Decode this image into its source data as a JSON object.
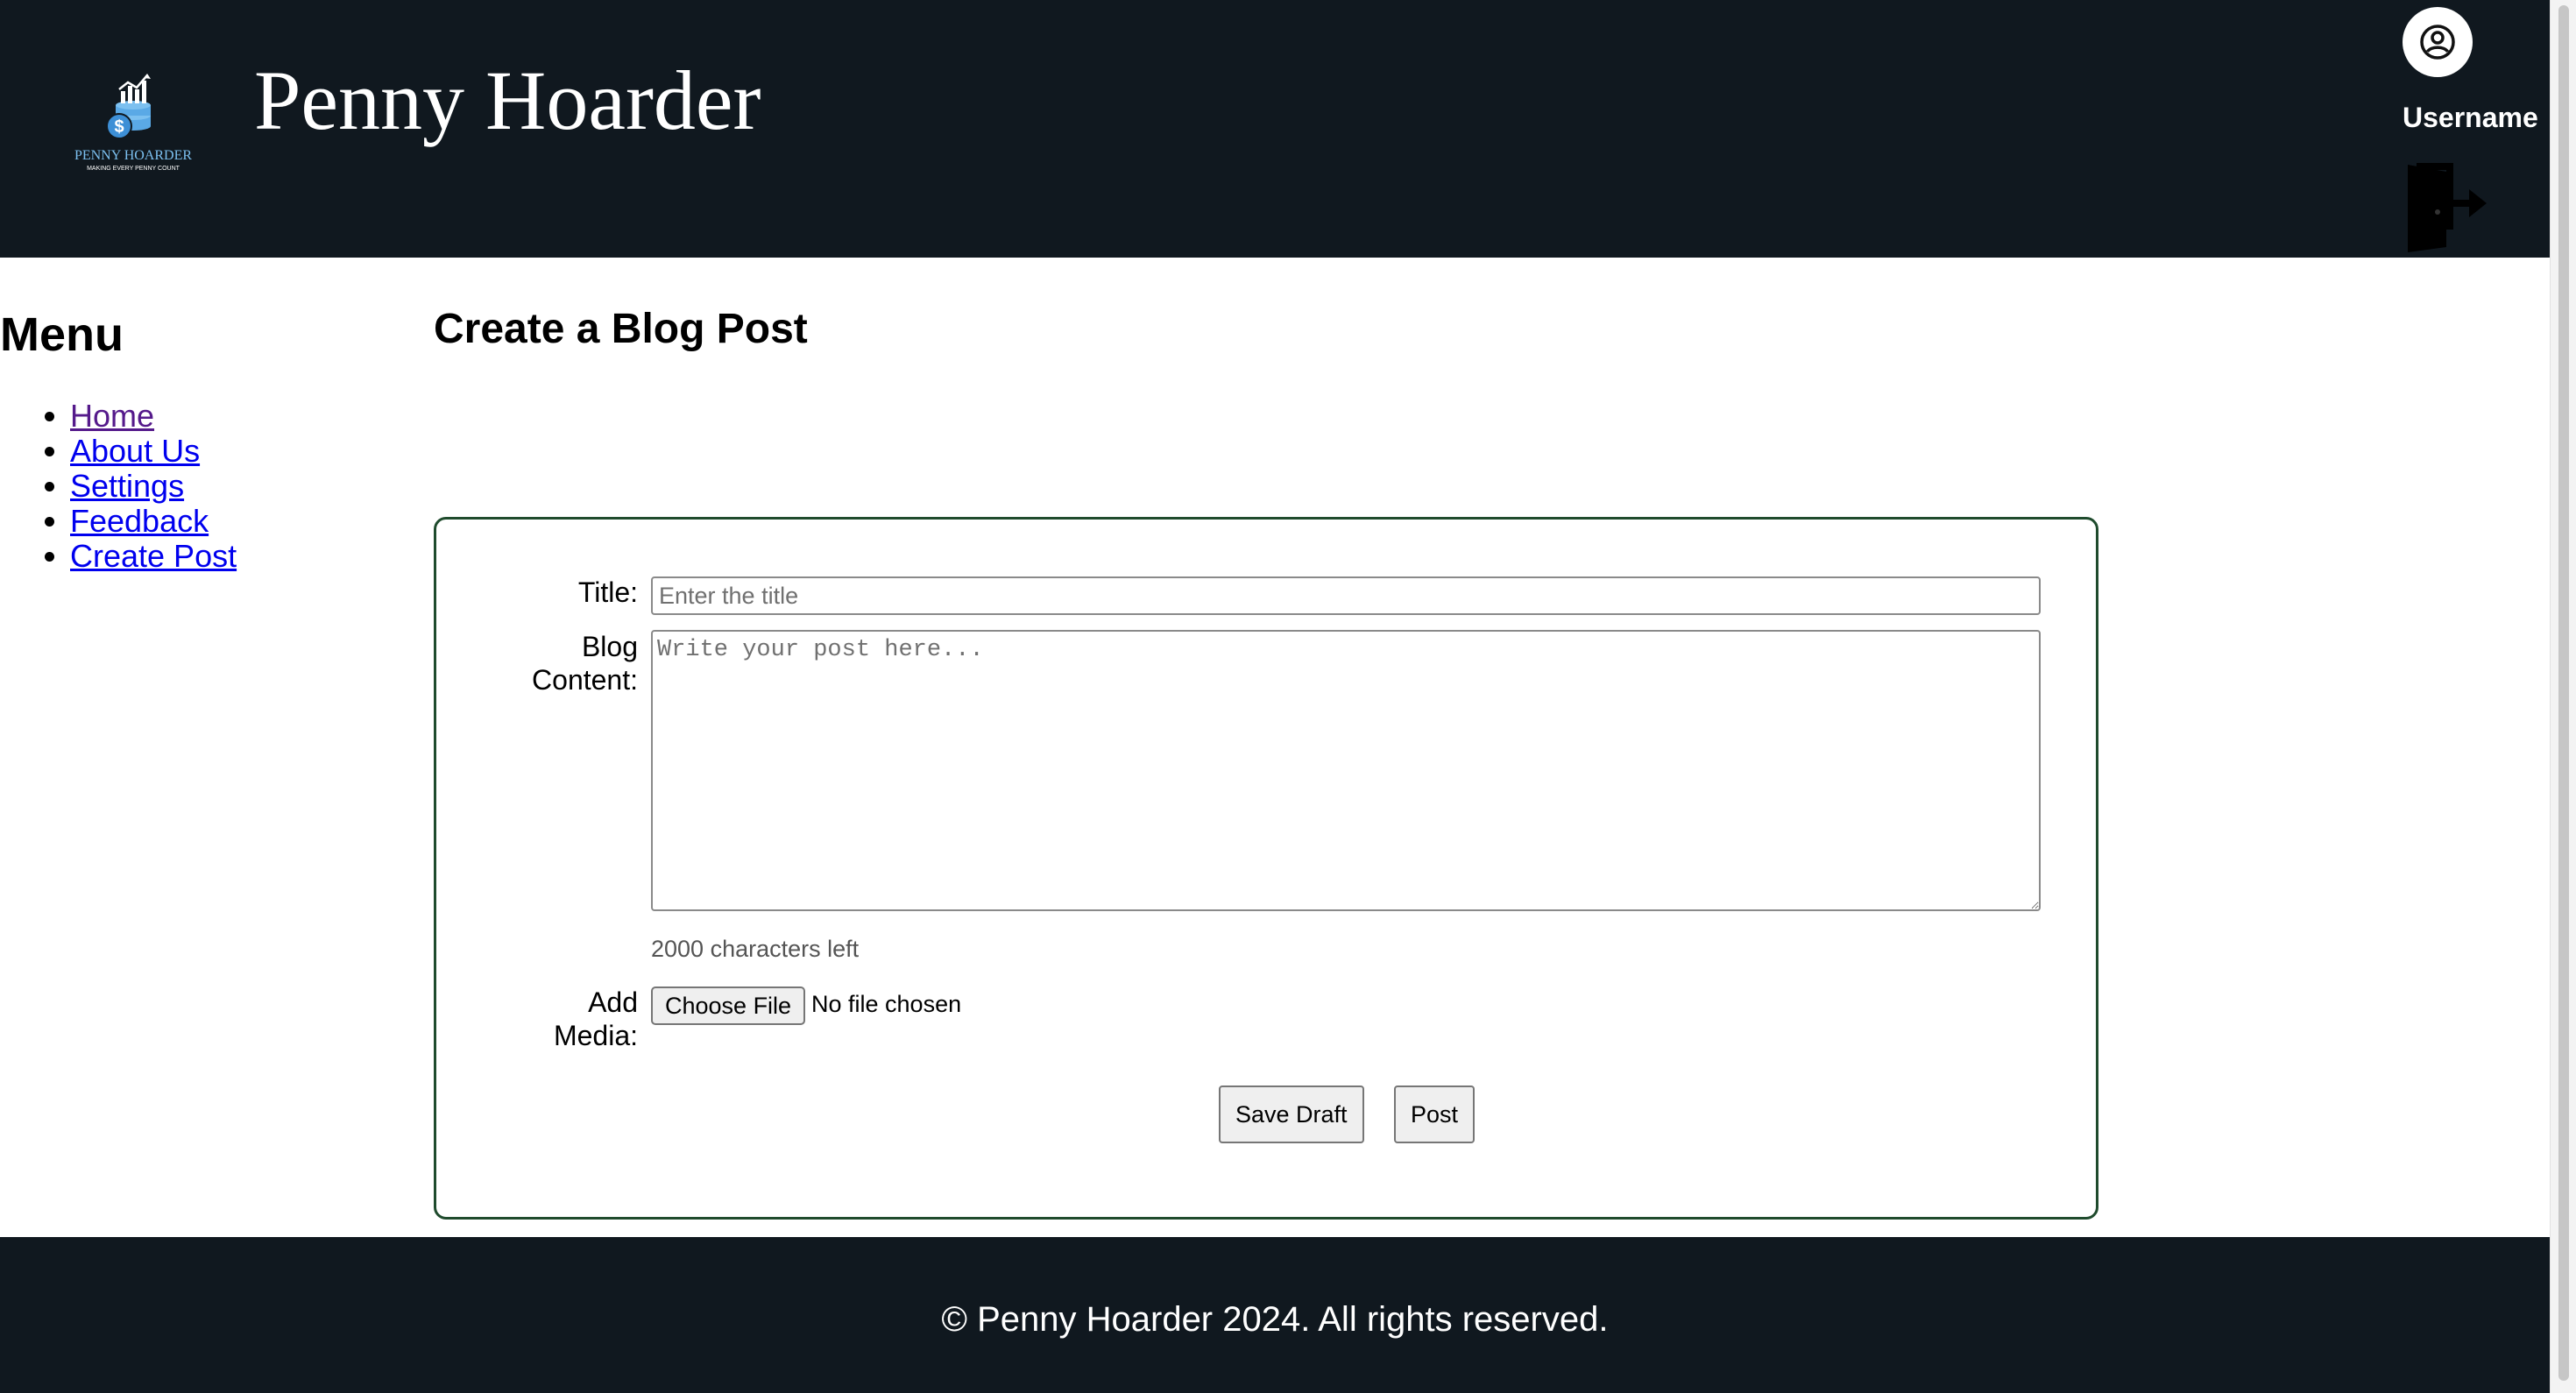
{
  "header": {
    "site_title": "Penny Hoarder",
    "logo_text": "PENNY HOARDER",
    "logo_tagline": "MAKING EVERY PENNY COUNT",
    "username": "Username",
    "icons": {
      "avatar": "user-circle-icon",
      "logout": "logout-door-icon"
    }
  },
  "sidebar": {
    "heading": "Menu",
    "items": [
      {
        "label": "Home",
        "visited": true
      },
      {
        "label": "About Us"
      },
      {
        "label": "Settings"
      },
      {
        "label": "Feedback"
      },
      {
        "label": "Create Post"
      }
    ]
  },
  "main": {
    "page_title": "Create a Blog Post",
    "form": {
      "title_label": "Title:",
      "title_placeholder": "Enter the title",
      "title_value": "",
      "content_label_line1": "Blog",
      "content_label_line2": "Content:",
      "content_placeholder": "Write your post here...",
      "content_value": "",
      "char_count": "2000 characters left",
      "media_label_line1": "Add",
      "media_label_line2": "Media:",
      "file_button": "Choose File",
      "file_status": "No file chosen",
      "save_draft_label": "Save Draft",
      "post_label": "Post"
    }
  },
  "footer": {
    "text": "© Penny Hoarder 2024. All rights reserved."
  },
  "colors": {
    "header_bg": "#10181f",
    "footer_bg": "#10181f",
    "form_border": "#1f4b2d",
    "link": "#0000ee",
    "link_visited": "#551a8b",
    "logo_blue": "#5aa9e6"
  }
}
